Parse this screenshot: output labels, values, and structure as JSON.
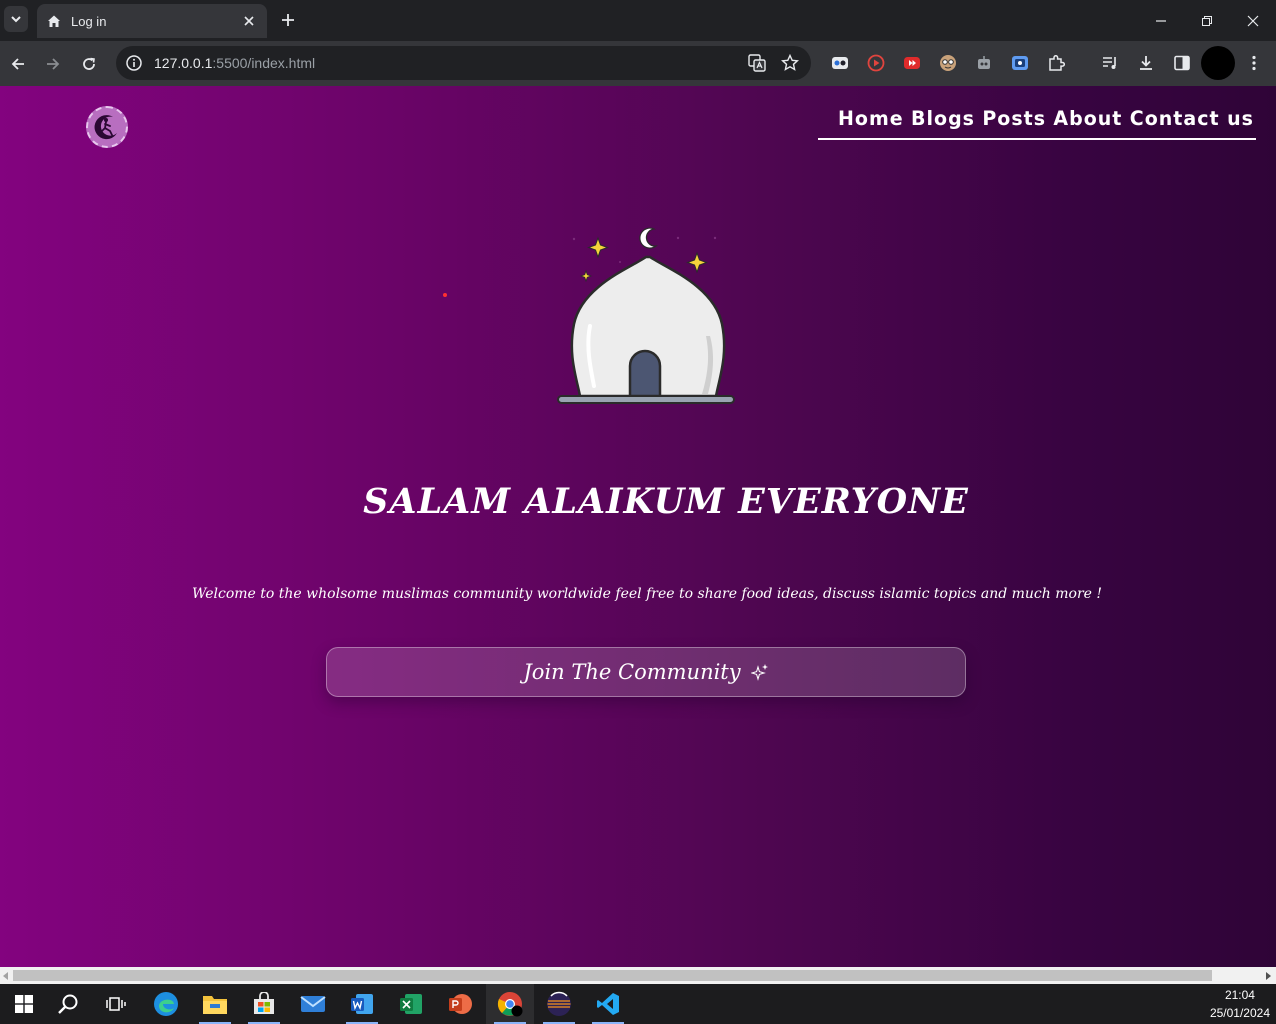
{
  "browser": {
    "tab_title": "Log in",
    "url_host": "127.0.0.1",
    "url_rest": ":5500/index.html"
  },
  "nav": {
    "items": [
      "Home",
      "Blogs",
      "Posts",
      "About",
      "Contact us"
    ]
  },
  "hero": {
    "heading": "SALAM ALAIKUM EVERYONE",
    "welcome": "Welcome to the wholsome muslimas community worldwide feel free to share food ideas, discuss islamic topics and much more !",
    "cta_label": "Join The Community"
  },
  "taskbar": {
    "time": "21:04",
    "date": "25/01/2024"
  },
  "colors": {
    "gradient_start": "#83037f",
    "gradient_end": "#2f0437",
    "text": "#ffffff"
  }
}
